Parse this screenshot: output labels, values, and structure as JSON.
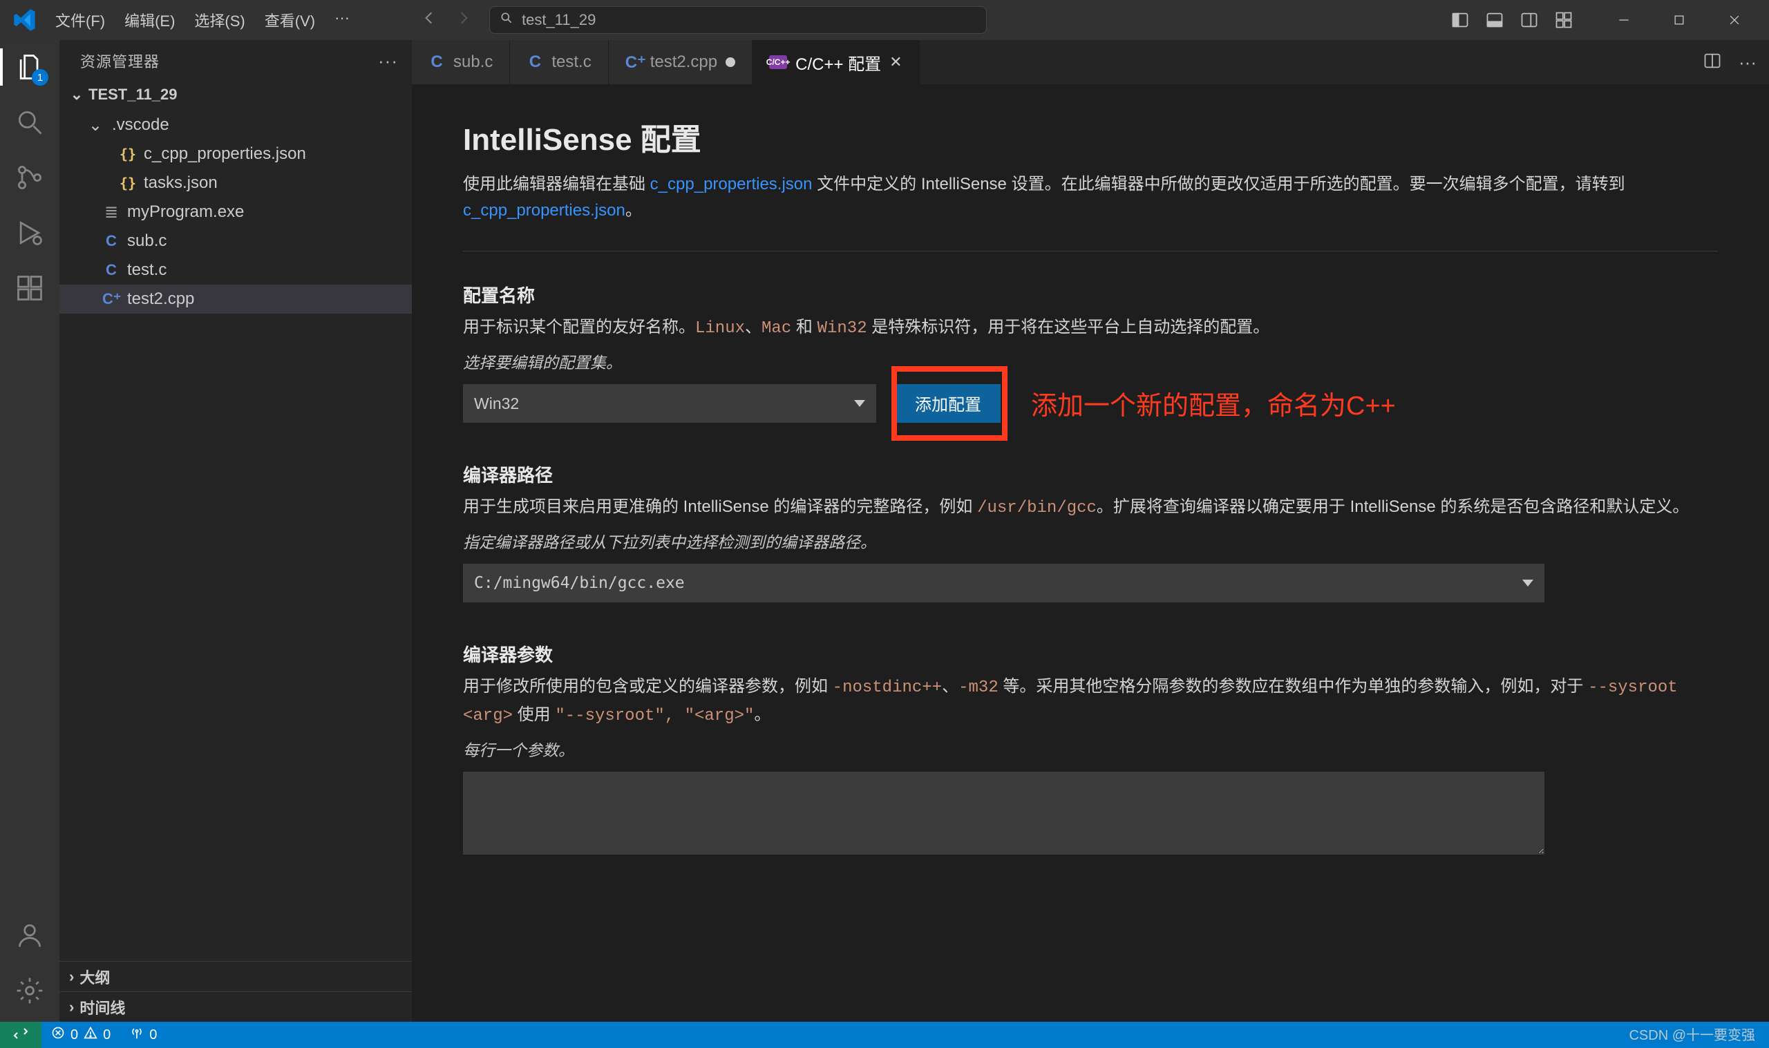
{
  "title_bar": {
    "menus": [
      "文件(F)",
      "编辑(E)",
      "选择(S)",
      "查看(V)",
      "···"
    ],
    "search_text": "test_11_29"
  },
  "activity_bar": {
    "explorer_badge": "1"
  },
  "sidebar": {
    "title": "资源管理器",
    "project": "TEST_11_29",
    "folder_vscode": ".vscode",
    "files": {
      "c_cpp_properties": "c_cpp_properties.json",
      "tasks": "tasks.json",
      "my_program": "myProgram.exe",
      "sub_c": "sub.c",
      "test_c": "test.c",
      "test2_cpp": "test2.cpp"
    },
    "panel_outline": "大纲",
    "panel_timeline": "时间线"
  },
  "tabs": {
    "t1": "sub.c",
    "t2": "test.c",
    "t3": "test2.cpp",
    "t4": "C/C++ 配置"
  },
  "content": {
    "h1": "IntelliSense 配置",
    "intro_pre": "使用此编辑器编辑在基础 ",
    "intro_link1": "c_cpp_properties.json",
    "intro_mid": " 文件中定义的 IntelliSense 设置。在此编辑器中所做的更改仅适用于所选的配置。要一次编辑多个配置，请转到 ",
    "intro_link2": "c_cpp_properties.json",
    "intro_post": "。",
    "s1_title": "配置名称",
    "s1_desc_pre": "用于标识某个配置的友好名称。",
    "s1_code1": "Linux",
    "s1_sep1": "、",
    "s1_code2": "Mac",
    "s1_sep2": " 和 ",
    "s1_code3": "Win32",
    "s1_desc_post": " 是特殊标识符，用于将在这些平台上自动选择的配置。",
    "s1_hint": "选择要编辑的配置集。",
    "s1_select_value": "Win32",
    "s1_button": "添加配置",
    "s1_annotation": "添加一个新的配置，命名为C++",
    "s2_title": "编译器路径",
    "s2_desc_pre": "用于生成项目来启用更准确的 IntelliSense 的编译器的完整路径，例如 ",
    "s2_code": "/usr/bin/gcc",
    "s2_desc_post": "。扩展将查询编译器以确定要用于 IntelliSense 的系统是否包含路径和默认定义。",
    "s2_hint": "指定编译器路径或从下拉列表中选择检测到的编译器路径。",
    "s2_value": "C:/mingw64/bin/gcc.exe",
    "s3_title": "编译器参数",
    "s3_desc_pre": "用于修改所使用的包含或定义的编译器参数，例如 ",
    "s3_code1": "-nostdinc++",
    "s3_sep1": "、",
    "s3_code2": "-m32",
    "s3_desc_mid": " 等。采用其他空格分隔参数的参数应在数组中作为单独的参数输入，例如，对于 ",
    "s3_code3": "--sysroot <arg>",
    "s3_desc_mid2": " 使用 ",
    "s3_code4": "\"--sysroot\", \"<arg>\"",
    "s3_desc_post": "。",
    "s3_hint": "每行一个参数。",
    "s3_value": ""
  },
  "status": {
    "errors": "0",
    "warnings": "0",
    "ports": "0"
  },
  "watermark": "CSDN @十一要变强"
}
